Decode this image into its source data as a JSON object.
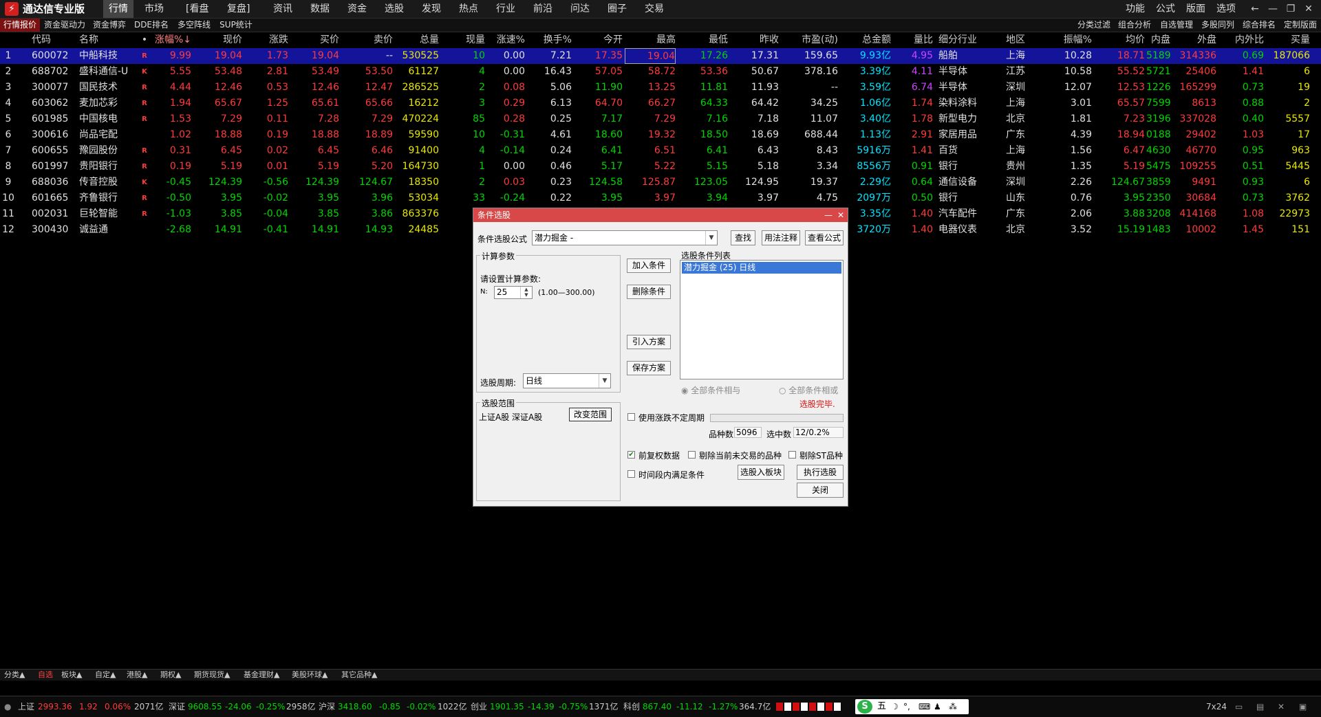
{
  "app": {
    "title": "通达信专业版",
    "logo_char": "⚡"
  },
  "menu": {
    "left": [
      "行情",
      "市场",
      "[看盘",
      "复盘]",
      "资讯",
      "数据",
      "资金",
      "选股",
      "发现",
      "热点",
      "行业",
      "前沿",
      "问达",
      "圈子",
      "交易"
    ],
    "right": [
      "功能",
      "公式",
      "版面",
      "选项"
    ]
  },
  "subtabs": {
    "left": [
      "行情报价",
      "资金驱动力",
      "资金博弈",
      "DDE排名",
      "多空阵线",
      "SUP统计"
    ],
    "right": [
      "分类过滤",
      "组合分析",
      "自选管理",
      "多股同列",
      "综合排名",
      "定制版面"
    ]
  },
  "table": {
    "headers": [
      "",
      "代码",
      "名称",
      "•",
      "涨幅%↓",
      "现价",
      "涨跌",
      "买价",
      "卖价",
      "总量",
      "现量",
      "涨速%",
      "换手%",
      "今开",
      "最高",
      "最低",
      "昨收",
      "市盈(动)",
      "总金额",
      "量比",
      "细分行业",
      "地区",
      "振幅%",
      "均价",
      "内盘",
      "外盘",
      "内外比",
      "买量"
    ],
    "rows": [
      {
        "i": "1",
        "code": "600072",
        "name": "中船科技",
        "flag": "R",
        "chg_pct": "9.99",
        "price": "19.04",
        "chg": "1.73",
        "bid": "19.04",
        "ask": "--",
        "vol": "530525",
        "cur_vol": "10",
        "speed": "0.00",
        "turnover": "7.21",
        "open": "17.35",
        "high": "19.04",
        "low": "17.26",
        "prev": "17.31",
        "pe": "159.65",
        "amount": "9.93亿",
        "vol_ratio": "4.95",
        "industry": "船舶",
        "region": "上海",
        "amp": "10.28",
        "avg": "18.71",
        "inner": "5189",
        "outer": "314336",
        "io_ratio": "0.69",
        "bid_vol": "187066"
      },
      {
        "i": "2",
        "code": "688702",
        "name": "盛科通信-U",
        "flag": "K",
        "chg_pct": "5.55",
        "price": "53.48",
        "chg": "2.81",
        "bid": "53.49",
        "ask": "53.50",
        "vol": "61127",
        "cur_vol": "4",
        "speed": "0.00",
        "turnover": "16.43",
        "open": "57.05",
        "high": "58.72",
        "low": "53.36",
        "prev": "50.67",
        "pe": "378.16",
        "amount": "3.39亿",
        "vol_ratio": "4.11",
        "industry": "半导体",
        "region": "江苏",
        "amp": "10.58",
        "avg": "55.52",
        "inner": "5721",
        "outer": "25406",
        "io_ratio": "1.41",
        "bid_vol": "6"
      },
      {
        "i": "3",
        "code": "300077",
        "name": "国民技术",
        "flag": "R",
        "chg_pct": "4.44",
        "price": "12.46",
        "chg": "0.53",
        "bid": "12.46",
        "ask": "12.47",
        "vol": "286525",
        "cur_vol": "2",
        "speed": "0.08",
        "turnover": "5.06",
        "open": "11.90",
        "high": "13.25",
        "low": "11.81",
        "prev": "11.93",
        "pe": "--",
        "amount": "3.59亿",
        "vol_ratio": "6.74",
        "industry": "半导体",
        "region": "深圳",
        "amp": "12.07",
        "avg": "12.53",
        "inner": "1226",
        "outer": "165299",
        "io_ratio": "0.73",
        "bid_vol": "19"
      },
      {
        "i": "4",
        "code": "603062",
        "name": "麦加芯彩",
        "flag": "R",
        "chg_pct": "1.94",
        "price": "65.67",
        "chg": "1.25",
        "bid": "65.61",
        "ask": "65.66",
        "vol": "16212",
        "cur_vol": "3",
        "speed": "0.29",
        "turnover": "6.13",
        "open": "64.70",
        "high": "66.27",
        "low": "64.33",
        "prev": "64.42",
        "pe": "34.25",
        "amount": "1.06亿",
        "vol_ratio": "1.74",
        "industry": "染料涂料",
        "region": "上海",
        "amp": "3.01",
        "avg": "65.57",
        "inner": "7599",
        "outer": "8613",
        "io_ratio": "0.88",
        "bid_vol": "2"
      },
      {
        "i": "5",
        "code": "601985",
        "name": "中国核电",
        "flag": "R",
        "chg_pct": "1.53",
        "price": "7.29",
        "chg": "0.11",
        "bid": "7.28",
        "ask": "7.29",
        "vol": "470224",
        "cur_vol": "85",
        "speed": "0.28",
        "turnover": "0.25",
        "open": "7.17",
        "high": "7.29",
        "low": "7.16",
        "prev": "7.18",
        "pe": "11.07",
        "amount": "3.40亿",
        "vol_ratio": "1.78",
        "industry": "新型电力",
        "region": "北京",
        "amp": "1.81",
        "avg": "7.23",
        "inner": "3196",
        "outer": "337028",
        "io_ratio": "0.40",
        "bid_vol": "5557"
      },
      {
        "i": "6",
        "code": "300616",
        "name": "尚品宅配",
        "flag": "",
        "chg_pct": "1.02",
        "price": "18.88",
        "chg": "0.19",
        "bid": "18.88",
        "ask": "18.89",
        "vol": "59590",
        "cur_vol": "10",
        "speed": "-0.31",
        "turnover": "4.61",
        "open": "18.60",
        "high": "19.32",
        "low": "18.50",
        "prev": "18.69",
        "pe": "688.44",
        "amount": "1.13亿",
        "vol_ratio": "2.91",
        "industry": "家居用品",
        "region": "广东",
        "amp": "4.39",
        "avg": "18.94",
        "inner": "0188",
        "outer": "29402",
        "io_ratio": "1.03",
        "bid_vol": "17"
      },
      {
        "i": "7",
        "code": "600655",
        "name": "豫园股份",
        "flag": "R",
        "chg_pct": "0.31",
        "price": "6.45",
        "chg": "0.02",
        "bid": "6.45",
        "ask": "6.46",
        "vol": "91400",
        "cur_vol": "4",
        "speed": "-0.14",
        "turnover": "0.24",
        "open": "6.41",
        "high": "6.51",
        "low": "6.41",
        "prev": "6.43",
        "pe": "8.43",
        "amount": "5916万",
        "vol_ratio": "1.41",
        "industry": "百货",
        "region": "上海",
        "amp": "1.56",
        "avg": "6.47",
        "inner": "4630",
        "outer": "46770",
        "io_ratio": "0.95",
        "bid_vol": "963"
      },
      {
        "i": "8",
        "code": "601997",
        "name": "贵阳银行",
        "flag": "R",
        "chg_pct": "0.19",
        "price": "5.19",
        "chg": "0.01",
        "bid": "5.19",
        "ask": "5.20",
        "vol": "164730",
        "cur_vol": "1",
        "speed": "0.00",
        "turnover": "0.46",
        "open": "5.17",
        "high": "5.22",
        "low": "5.15",
        "prev": "5.18",
        "pe": "3.34",
        "amount": "8556万",
        "vol_ratio": "0.91",
        "industry": "银行",
        "region": "贵州",
        "amp": "1.35",
        "avg": "5.19",
        "inner": "5475",
        "outer": "109255",
        "io_ratio": "0.51",
        "bid_vol": "5445"
      },
      {
        "i": "9",
        "code": "688036",
        "name": "传音控股",
        "flag": "K",
        "chg_pct": "-0.45",
        "price": "124.39",
        "chg": "-0.56",
        "bid": "124.39",
        "ask": "124.67",
        "vol": "18350",
        "cur_vol": "2",
        "speed": "0.03",
        "turnover": "0.23",
        "open": "124.58",
        "high": "125.87",
        "low": "123.05",
        "prev": "124.95",
        "pe": "19.37",
        "amount": "2.29亿",
        "vol_ratio": "0.64",
        "industry": "通信设备",
        "region": "深圳",
        "amp": "2.26",
        "avg": "124.67",
        "inner": "3859",
        "outer": "9491",
        "io_ratio": "0.93",
        "bid_vol": "6"
      },
      {
        "i": "10",
        "code": "601665",
        "name": "齐鲁银行",
        "flag": "R",
        "chg_pct": "-0.50",
        "price": "3.95",
        "chg": "-0.02",
        "bid": "3.95",
        "ask": "3.96",
        "vol": "53034",
        "cur_vol": "33",
        "speed": "-0.24",
        "turnover": "0.22",
        "open": "3.95",
        "high": "3.97",
        "low": "3.94",
        "prev": "3.97",
        "pe": "4.75",
        "amount": "2097万",
        "vol_ratio": "0.50",
        "industry": "银行",
        "region": "山东",
        "amp": "0.76",
        "avg": "3.95",
        "inner": "2350",
        "outer": "30684",
        "io_ratio": "0.73",
        "bid_vol": "3762"
      },
      {
        "i": "11",
        "code": "002031",
        "name": "巨轮智能",
        "flag": "R",
        "chg_pct": "-1.03",
        "price": "3.85",
        "chg": "-0.04",
        "bid": "3.85",
        "ask": "3.86",
        "vol": "863376",
        "cur_vol": "",
        "speed": "",
        "turnover": "",
        "open": "",
        "high": "",
        "low": "",
        "prev": "",
        "pe": "",
        "amount": "3.35亿",
        "vol_ratio": "1.40",
        "industry": "汽车配件",
        "region": "广东",
        "amp": "2.06",
        "avg": "3.88",
        "inner": "3208",
        "outer": "414168",
        "io_ratio": "1.08",
        "bid_vol": "22973"
      },
      {
        "i": "12",
        "code": "300430",
        "name": "诚益通",
        "flag": "",
        "chg_pct": "-2.68",
        "price": "14.91",
        "chg": "-0.41",
        "bid": "14.91",
        "ask": "14.93",
        "vol": "24485",
        "cur_vol": "",
        "speed": "",
        "turnover": "",
        "open": "",
        "high": "",
        "low": "",
        "prev": "",
        "pe": "",
        "amount": "3720万",
        "vol_ratio": "1.40",
        "industry": "电器仪表",
        "region": "北京",
        "amp": "3.52",
        "avg": "15.19",
        "inner": "1483",
        "outer": "10002",
        "io_ratio": "1.45",
        "bid_vol": "151"
      }
    ]
  },
  "dialog": {
    "title": "条件选股",
    "formula_label": "条件选股公式",
    "formula_value": "潜力掘金    -",
    "btn_find": "查找",
    "btn_usage": "用法注释",
    "btn_view_formula": "查看公式",
    "calc_params_label": "计算参数",
    "set_params_text": "请设置计算参数:",
    "n_label": "N:",
    "n_value": "25",
    "n_range": "(1.00—300.00)",
    "period_label": "选股周期:",
    "period_value": "日线",
    "btn_add": "加入条件",
    "btn_delete": "删除条件",
    "btn_import": "引入方案",
    "btn_save": "保存方案",
    "list_label": "选股条件列表",
    "list_items": [
      "潜力掘金 (25) 日线"
    ],
    "radio_and": "全部条件相与",
    "radio_or": "全部条件相或",
    "done_text": "选股完毕.",
    "scope_label": "选股范围",
    "scope_value": "上证A股 深证A股",
    "btn_change_scope": "改变范围",
    "chk_use_period": "使用涨跌不定周期",
    "count_label": "品种数",
    "count_value": "5096",
    "selected_label": "选中数",
    "selected_value": "12/0.2%",
    "chk_prior_adj": "前复权数据",
    "chk_remove_untraded": "剔除当前未交易的品种",
    "chk_remove_st": "剔除ST品种",
    "chk_time_range": "时间段内满足条件",
    "btn_to_block": "选股入板块",
    "btn_execute": "执行选股",
    "btn_close": "关闭"
  },
  "bottom_tabs": [
    "分类▲",
    "自选",
    "板块▲",
    "自定▲",
    "港股▲",
    "期权▲",
    "期货现货▲",
    "基金理财▲",
    "美股环球▲",
    "其它品种▲"
  ],
  "status": {
    "sh_label": "上证",
    "sh_val": "2993.36",
    "sh_chg": "1.92",
    "sh_pct": "0.06%",
    "sh_amt": "2071亿",
    "sz_label": "深证",
    "sz_val": "9608.55",
    "sz_chg": "-24.06",
    "sz_pct": "-0.25%",
    "sz_amt": "2958亿",
    "hs_label": "沪深",
    "hs_val": "3418.60",
    "hs_chg": "-0.85",
    "hs_pct": "-0.02%",
    "hs_amt": "1022亿",
    "cy_label": "创业",
    "cy_val": "1901.35",
    "cy_chg": "-14.39",
    "cy_pct": "-0.75%",
    "cy_amt": "1371亿",
    "kc_label": "科创",
    "kc_val": "867.40",
    "kc_chg": "-11.12",
    "kc_pct": "-1.27%",
    "kc_amt": "364.7亿",
    "ime": "五",
    "time_mode": "7x24"
  },
  "colors": {
    "up": "#ff3b3b",
    "down": "#00d700",
    "accent": "#d94848",
    "selected_row": "#14149b"
  }
}
